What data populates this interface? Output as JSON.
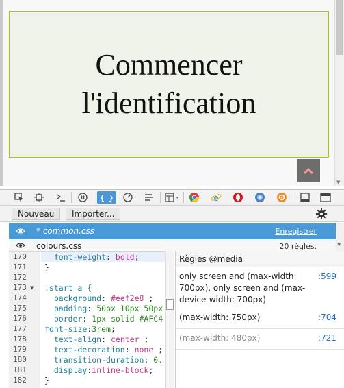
{
  "viewport": {
    "start_link": "Commencer l'identification"
  },
  "toolbar": {
    "tools": [
      {
        "name": "pick-element-icon"
      },
      {
        "name": "inspector-icon"
      },
      {
        "name": "console-icon"
      },
      {
        "name": "debugger-icon"
      },
      {
        "name": "style-editor-icon",
        "label": "{ }"
      },
      {
        "name": "performance-icon"
      },
      {
        "name": "network-icon"
      },
      {
        "name": "split-view-icon"
      },
      {
        "name": "chrome-icon"
      },
      {
        "name": "ie-icon"
      },
      {
        "name": "opera-icon"
      },
      {
        "name": "globe-icon"
      },
      {
        "name": "settings-orange-icon"
      },
      {
        "name": "responsive-icon"
      },
      {
        "name": "dock-icon"
      }
    ]
  },
  "subbar": {
    "new_label": "Nouveau",
    "import_label": "Importer..."
  },
  "sheets": [
    {
      "name": "* common.css",
      "action": "Enregistrer"
    },
    {
      "name": "colours.css",
      "rules": "20 règles."
    }
  ],
  "editor": {
    "lines": [
      {
        "n": "170",
        "fold": ""
      },
      {
        "n": "171",
        "fold": ""
      },
      {
        "n": "172",
        "fold": ""
      },
      {
        "n": "173",
        "fold": "▼"
      },
      {
        "n": "174",
        "fold": ""
      },
      {
        "n": "175",
        "fold": ""
      },
      {
        "n": "176",
        "fold": ""
      },
      {
        "n": "177",
        "fold": ""
      },
      {
        "n": "178",
        "fold": ""
      },
      {
        "n": "179",
        "fold": ""
      },
      {
        "n": "180",
        "fold": ""
      },
      {
        "n": "181",
        "fold": ""
      },
      {
        "n": "182",
        "fold": ""
      }
    ],
    "code": {
      "l170_prop": "font-weight",
      "l170_val": "bold",
      "l171": "}",
      "l173_sel": ".start a {",
      "l174_prop": "background",
      "l174_val": "#eef2e8",
      "l175_prop": "padding",
      "l175_val": "50px 10px 50px",
      "l176_prop": "border",
      "l176_val": "1px solid #AFC4",
      "l177_prop": "font-size",
      "l177_val": "3rem",
      "l178_prop": "text-align",
      "l178_val": "center",
      "l179_prop": "text-decoration",
      "l179_val": "none",
      "l180_prop": "transition-duration",
      "l180_val": "0.",
      "l181_prop": "display",
      "l181_val": "inline-block",
      "l182": "}"
    }
  },
  "media": {
    "title": "Règles @media",
    "rules": [
      {
        "text": "only screen and (max-width: 700px), only screen and (max-device-width: 700px)",
        "line": ":599"
      },
      {
        "text": "(max-width: 750px)",
        "line": ":704"
      },
      {
        "text": "(max-width: 480px)",
        "line": ":721"
      }
    ]
  },
  "colors": {
    "accent": "#4b9ad8",
    "start_bg": "#eef2e8",
    "start_border": "#afc400",
    "scrolltop": "#6d6d6d"
  }
}
